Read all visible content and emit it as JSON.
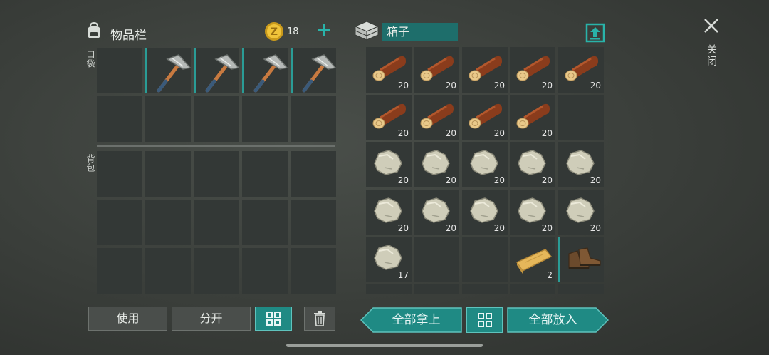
{
  "inventory": {
    "title": "物品栏",
    "coin_count": "18",
    "pocket_label": "口袋",
    "backpack_label": "背包",
    "pocket_items": [
      {
        "type": "empty"
      },
      {
        "type": "pickaxe",
        "icon": "pickaxe-icon"
      },
      {
        "type": "pickaxe",
        "icon": "pickaxe-icon"
      },
      {
        "type": "pickaxe",
        "icon": "pickaxe-icon"
      },
      {
        "type": "pickaxe",
        "icon": "pickaxe-icon"
      }
    ]
  },
  "box": {
    "title": "箱子",
    "items": [
      {
        "type": "log",
        "count": "20"
      },
      {
        "type": "log",
        "count": "20"
      },
      {
        "type": "log",
        "count": "20"
      },
      {
        "type": "log",
        "count": "20"
      },
      {
        "type": "log",
        "count": "20"
      },
      {
        "type": "log",
        "count": "20"
      },
      {
        "type": "log",
        "count": "20"
      },
      {
        "type": "log",
        "count": "20"
      },
      {
        "type": "log",
        "count": "20"
      },
      {
        "type": "empty",
        "count": ""
      },
      {
        "type": "stone",
        "count": "20"
      },
      {
        "type": "stone",
        "count": "20"
      },
      {
        "type": "stone",
        "count": "20"
      },
      {
        "type": "stone",
        "count": "20"
      },
      {
        "type": "stone",
        "count": "20"
      },
      {
        "type": "stone",
        "count": "20"
      },
      {
        "type": "stone",
        "count": "20"
      },
      {
        "type": "stone",
        "count": "20"
      },
      {
        "type": "stone",
        "count": "20"
      },
      {
        "type": "stone",
        "count": "20"
      },
      {
        "type": "stone",
        "count": "17"
      },
      {
        "type": "empty",
        "count": ""
      },
      {
        "type": "empty",
        "count": ""
      },
      {
        "type": "plank",
        "count": "2"
      },
      {
        "type": "boots",
        "count": ""
      }
    ]
  },
  "buttons": {
    "use": "使用",
    "split": "分开",
    "take_all": "全部拿上",
    "put_all": "全部放入"
  },
  "close_label": "关闭",
  "colors": {
    "accent": "#1f8a84",
    "slot": "#333836",
    "active": "#2a9c96"
  }
}
